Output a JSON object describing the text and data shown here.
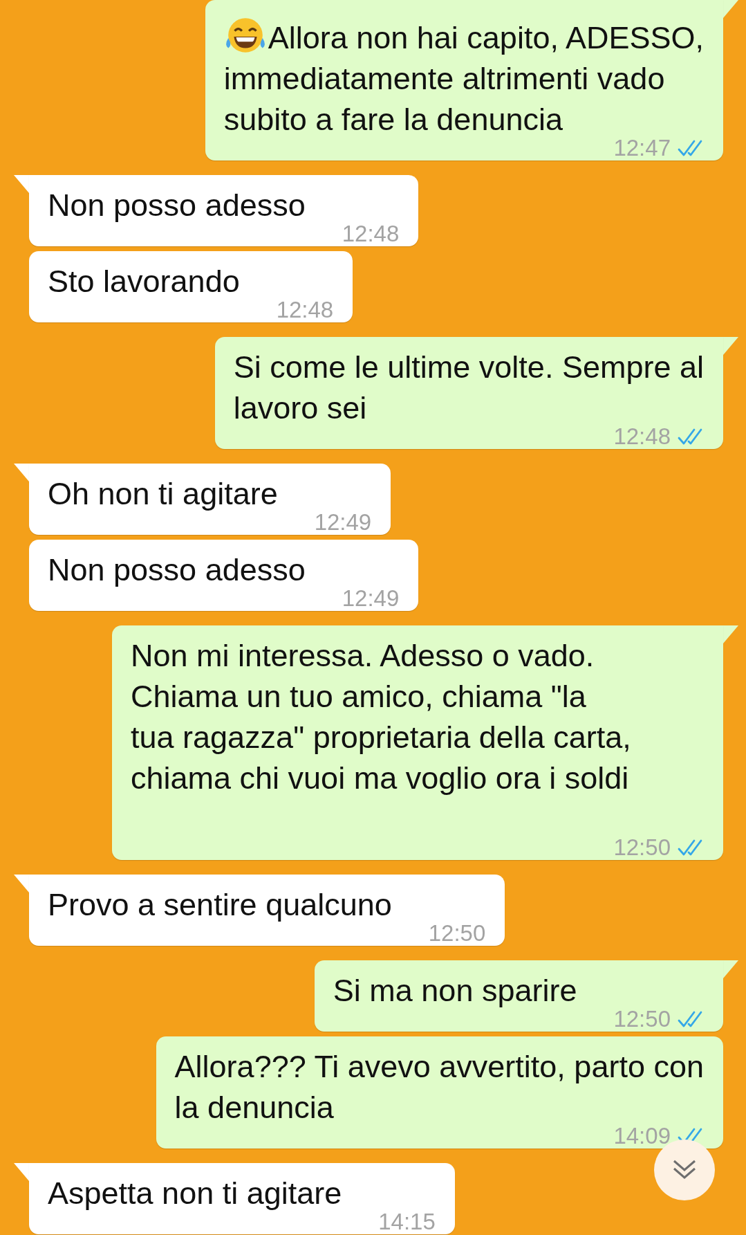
{
  "messages": [
    {
      "kind": "outgoing",
      "tail": true,
      "emoji": true,
      "text": "Allora non hai capito, ADESSO,\nimmediatamente altrimenti vado\nsubito a fare la denuncia",
      "time": "12:47",
      "read": true
    },
    {
      "kind": "incoming",
      "tail": true,
      "text": "Non posso adesso",
      "time": "12:48"
    },
    {
      "kind": "incoming",
      "tail": false,
      "text": "Sto lavorando",
      "time": "12:48"
    },
    {
      "kind": "outgoing",
      "tail": true,
      "text": "Si come le ultime volte. Sempre al\nlavoro sei",
      "time": "12:48",
      "read": true
    },
    {
      "kind": "incoming",
      "tail": true,
      "text": "Oh non ti agitare",
      "time": "12:49"
    },
    {
      "kind": "incoming",
      "tail": false,
      "text": "Non posso adesso",
      "time": "12:49"
    },
    {
      "kind": "outgoing",
      "tail": true,
      "text": "Non mi interessa. Adesso o vado.\nChiama un tuo amico, chiama \"la\ntua ragazza\" proprietaria della carta,\nchiama chi vuoi ma voglio ora i soldi",
      "time": "12:50",
      "read": true
    },
    {
      "kind": "incoming",
      "tail": true,
      "text": "Provo a sentire qualcuno",
      "time": "12:50"
    },
    {
      "kind": "outgoing",
      "tail": true,
      "text": "Si ma non sparire",
      "time": "12:50",
      "read": true
    },
    {
      "kind": "outgoing",
      "tail": false,
      "text": "Allora??? Ti avevo avvertito, parto con\nla denuncia",
      "time": "14:09",
      "read": true
    },
    {
      "kind": "incoming",
      "tail": true,
      "text": "Aspetta non ti agitare",
      "time": "14:15"
    }
  ],
  "scroll_down_button": true
}
